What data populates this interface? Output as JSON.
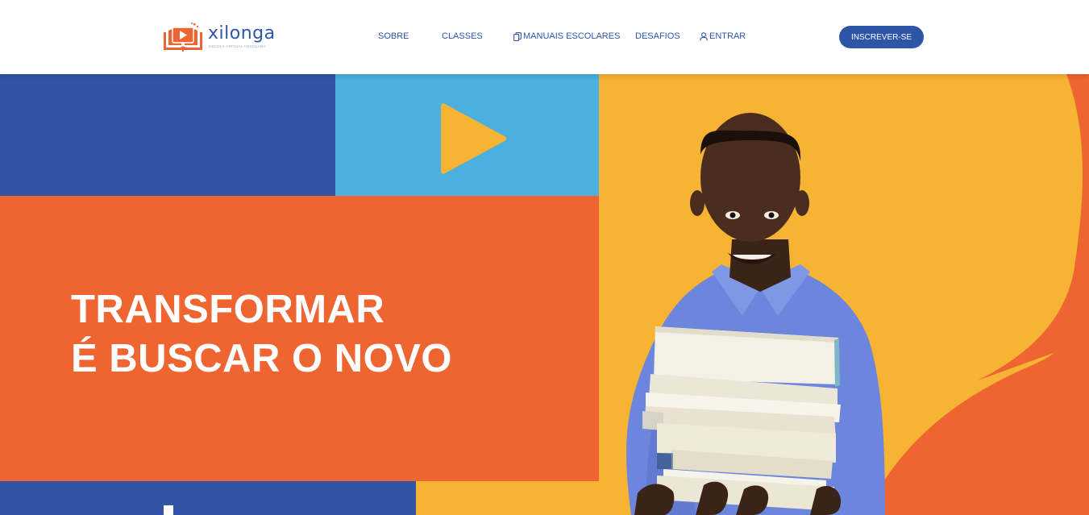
{
  "brand": {
    "name": "xilonga",
    "tagline": "ESCOLA VIRTUAL ANGOLANA"
  },
  "nav": {
    "sobre": "SOBRE",
    "classes": "CLASSES",
    "manuais": "MANUAIS ESCOLARES",
    "desafios": "DESAFIOS",
    "entrar": "ENTRAR"
  },
  "cta": {
    "label": "INSCREVER-SE"
  },
  "hero": {
    "headline_line1": "TRANSFORMAR",
    "headline_line2": "É BUSCAR O NOVO"
  },
  "icons": {
    "logo": "book-play-logo-icon",
    "manuais": "copy-icon",
    "entrar": "user-icon",
    "play": "play-icon"
  },
  "colors": {
    "primary_blue": "#3154a4",
    "light_blue": "#4bb0e0",
    "orange": "#ee6532",
    "yellow": "#f7b334",
    "white": "#ffffff"
  }
}
